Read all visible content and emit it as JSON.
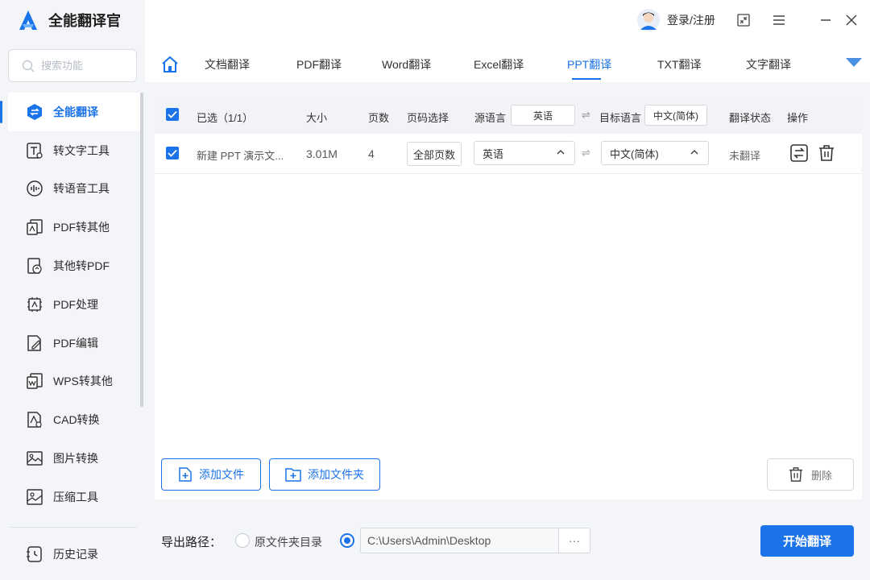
{
  "app": {
    "title": "全能翻译官"
  },
  "search": {
    "placeholder": "搜索功能"
  },
  "sidebar": {
    "items": [
      {
        "label": "全能翻译",
        "icon": "translate-icon",
        "active": true
      },
      {
        "label": "转文字工具",
        "icon": "text-tool-icon"
      },
      {
        "label": "转语音工具",
        "icon": "voice-tool-icon"
      },
      {
        "label": "PDF转其他",
        "icon": "pdf-convert-icon"
      },
      {
        "label": "其他转PDF",
        "icon": "to-pdf-icon"
      },
      {
        "label": "PDF处理",
        "icon": "pdf-process-icon"
      },
      {
        "label": "PDF编辑",
        "icon": "pdf-edit-icon"
      },
      {
        "label": "WPS转其他",
        "icon": "wps-convert-icon"
      },
      {
        "label": "CAD转换",
        "icon": "cad-convert-icon"
      },
      {
        "label": "图片转换",
        "icon": "image-convert-icon"
      },
      {
        "label": "压缩工具",
        "icon": "compress-icon"
      }
    ],
    "history": "历史记录"
  },
  "header": {
    "login": "登录/注册"
  },
  "tabs": [
    "文档翻译",
    "PDF翻译",
    "Word翻译",
    "Excel翻译",
    "PPT翻译",
    "TXT翻译",
    "文字翻译"
  ],
  "active_tab": "PPT翻译",
  "table": {
    "headers": {
      "selected": "已选（1/1）",
      "size": "大小",
      "pages": "页数",
      "page_select": "页码选择",
      "source_lang": "源语言",
      "source_lang_value": "英语",
      "target_lang": "目标语言",
      "target_lang_value": "中文(简体)",
      "status": "翻译状态",
      "action": "操作"
    },
    "rows": [
      {
        "name": "新建 PPT 演示文...",
        "size": "3.01M",
        "pages": "4",
        "page_select": "全部页数",
        "source": "英语",
        "target": "中文(简体)",
        "status": "未翻译"
      }
    ]
  },
  "buttons": {
    "add_file": "添加文件",
    "add_folder": "添加文件夹",
    "delete": "删除",
    "start": "开始翻译"
  },
  "export": {
    "label": "导出路径：",
    "option_original": "原文件夹目录",
    "path": "C:\\Users\\Admin\\Desktop",
    "browse": "···"
  },
  "colors": {
    "accent": "#1a73e8",
    "sidebar_bg": "#f3f5f8"
  }
}
